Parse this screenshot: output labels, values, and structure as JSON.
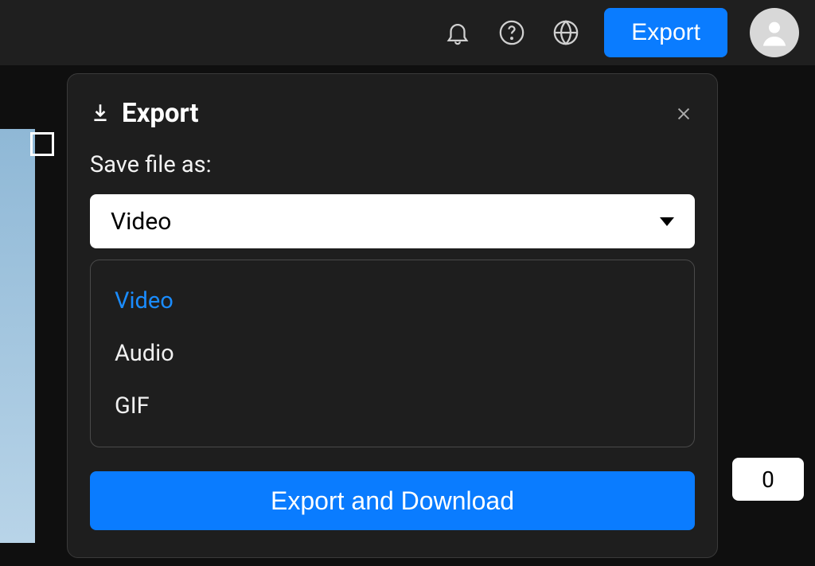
{
  "topbar": {
    "export_label": "Export"
  },
  "dialog": {
    "title": "Export",
    "save_label": "Save file as:",
    "selected_value": "Video",
    "options": [
      "Video",
      "Audio",
      "GIF"
    ],
    "primary_button": "Export and Download"
  },
  "side": {
    "number_value": "0"
  }
}
